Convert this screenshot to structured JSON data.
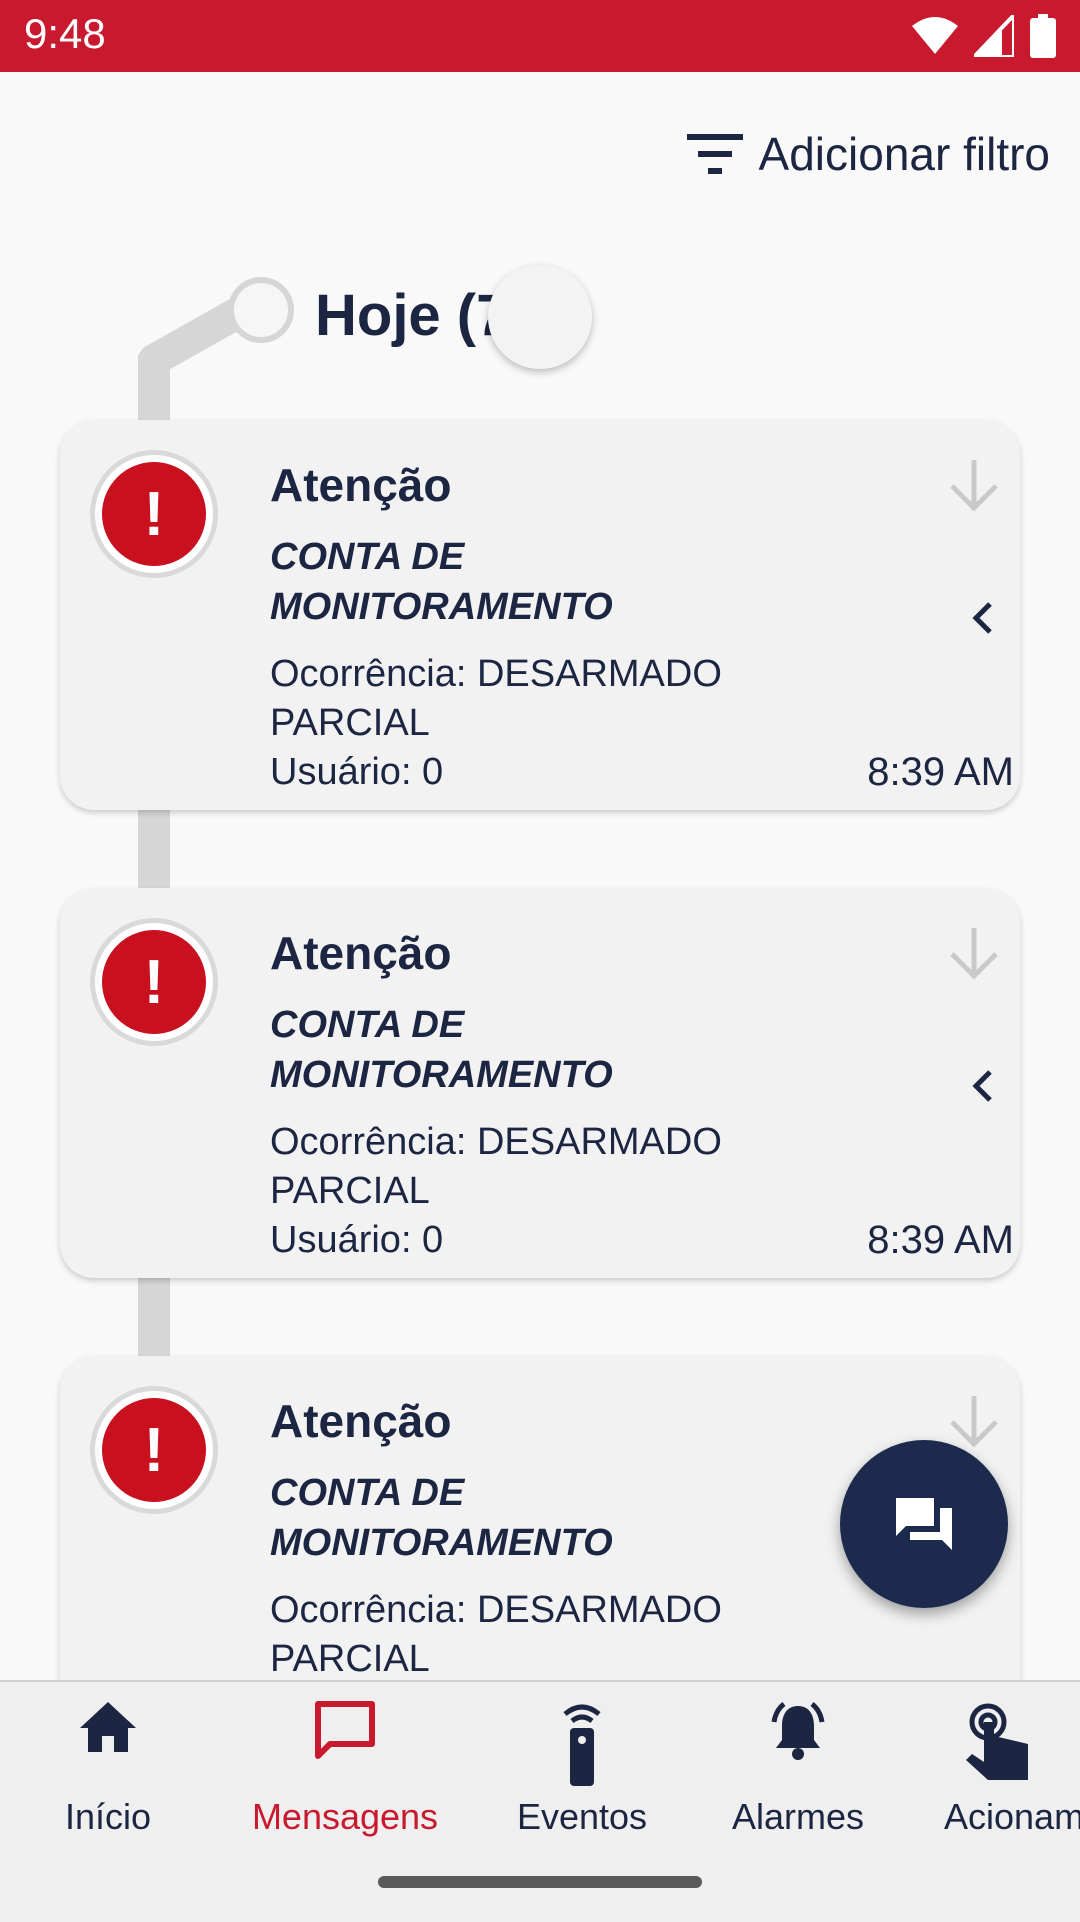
{
  "status_bar": {
    "time": "9:48"
  },
  "filter": {
    "label": "Adicionar filtro"
  },
  "date_group": {
    "label": "Hoje (7"
  },
  "cards": [
    {
      "title": "Atenção",
      "account": "CONTA DE MONITORAMENTO",
      "occurrence": "Ocorrência: DESARMADO PARCIAL",
      "user": "Usuário: 0",
      "time": "8:39 AM"
    },
    {
      "title": "Atenção",
      "account": "CONTA DE MONITORAMENTO",
      "occurrence": "Ocorrência: DESARMADO PARCIAL",
      "user": "Usuário: 0",
      "time": "8:39 AM"
    },
    {
      "title": "Atenção",
      "account": "CONTA DE MONITORAMENTO",
      "occurrence": "Ocorrência: DESARMADO PARCIAL",
      "user": "",
      "time": ""
    }
  ],
  "bottom_nav": {
    "items": [
      {
        "label": "Início",
        "icon": "home-icon",
        "active": false
      },
      {
        "label": "Mensagens",
        "icon": "message-icon",
        "active": true
      },
      {
        "label": "Eventos",
        "icon": "remote-icon",
        "active": false
      },
      {
        "label": "Alarmes",
        "icon": "bell-icon",
        "active": false
      },
      {
        "label": "Acionam",
        "icon": "touch-icon",
        "active": false
      }
    ]
  },
  "colors": {
    "accent": "#c8192e",
    "navy": "#1c2541",
    "alert": "#c8101e"
  }
}
